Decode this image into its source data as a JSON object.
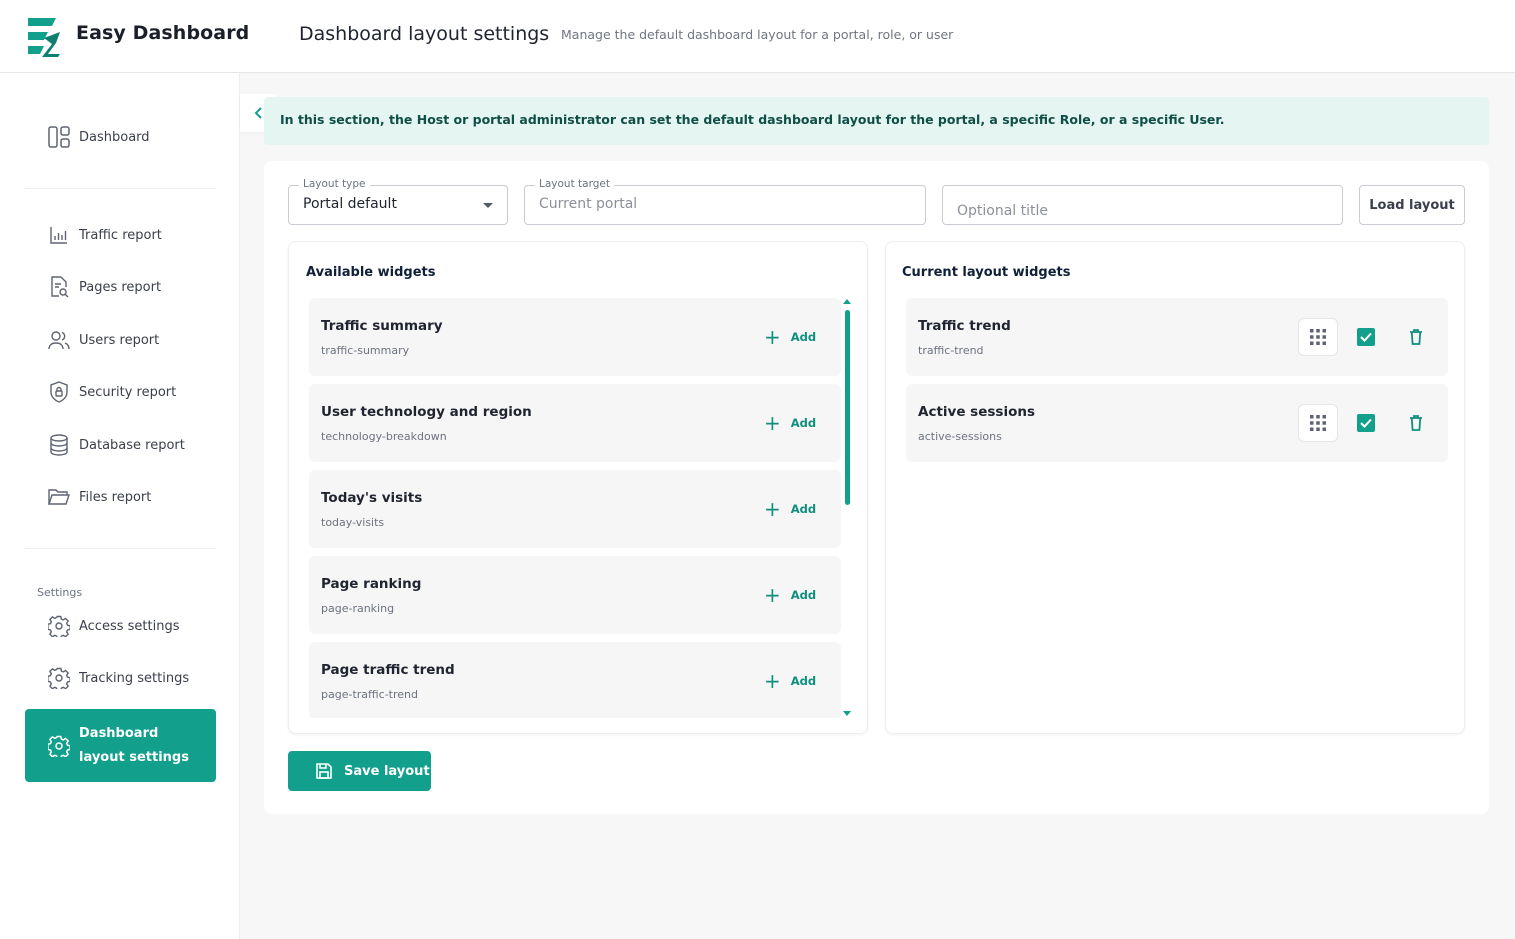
{
  "app": {
    "name": "Easy Dashboard",
    "logo_icon": "easy-dashboard-logo",
    "accent_color": "#12a08d"
  },
  "header": {
    "title": "Dashboard layout settings",
    "subtitle": "Manage the default dashboard layout for a portal, role, or user"
  },
  "sidebar": {
    "top": {
      "label": "Dashboard",
      "icon": "dashboard-icon"
    },
    "reports": [
      {
        "label": "Traffic report",
        "icon": "bar-chart-icon"
      },
      {
        "label": "Pages report",
        "icon": "page-search-icon"
      },
      {
        "label": "Users report",
        "icon": "users-icon"
      },
      {
        "label": "Security report",
        "icon": "shield-icon"
      },
      {
        "label": "Database report",
        "icon": "database-icon"
      },
      {
        "label": "Files report",
        "icon": "folder-icon"
      }
    ],
    "settings_section": "Settings",
    "settings": [
      {
        "label": "Access settings",
        "icon": "gear-icon"
      },
      {
        "label": "Tracking settings",
        "icon": "gear-icon"
      },
      {
        "label": "Dashboard layout settings",
        "icon": "gear-icon",
        "active": true
      }
    ]
  },
  "banner": {
    "text": "In this section, the Host or portal administrator can set the default dashboard layout for the portal, a specific Role, or a specific User."
  },
  "form": {
    "layout_type": {
      "label": "Layout type",
      "value": "Portal default"
    },
    "layout_target": {
      "label": "Layout target",
      "placeholder": "Current portal"
    },
    "optional_title": {
      "placeholder": "Optional title"
    },
    "load_button": "Load layout"
  },
  "available": {
    "title": "Available widgets",
    "add_label": "Add",
    "items": [
      {
        "name": "Traffic summary",
        "key": "traffic-summary"
      },
      {
        "name": "User technology and region",
        "key": "technology-breakdown"
      },
      {
        "name": "Today's visits",
        "key": "today-visits"
      },
      {
        "name": "Page ranking",
        "key": "page-ranking"
      },
      {
        "name": "Page traffic trend",
        "key": "page-traffic-trend"
      }
    ]
  },
  "current": {
    "title": "Current layout widgets",
    "items": [
      {
        "name": "Traffic trend",
        "key": "traffic-trend",
        "enabled": true
      },
      {
        "name": "Active sessions",
        "key": "active-sessions",
        "enabled": true
      }
    ]
  },
  "save_button": "Save layout"
}
